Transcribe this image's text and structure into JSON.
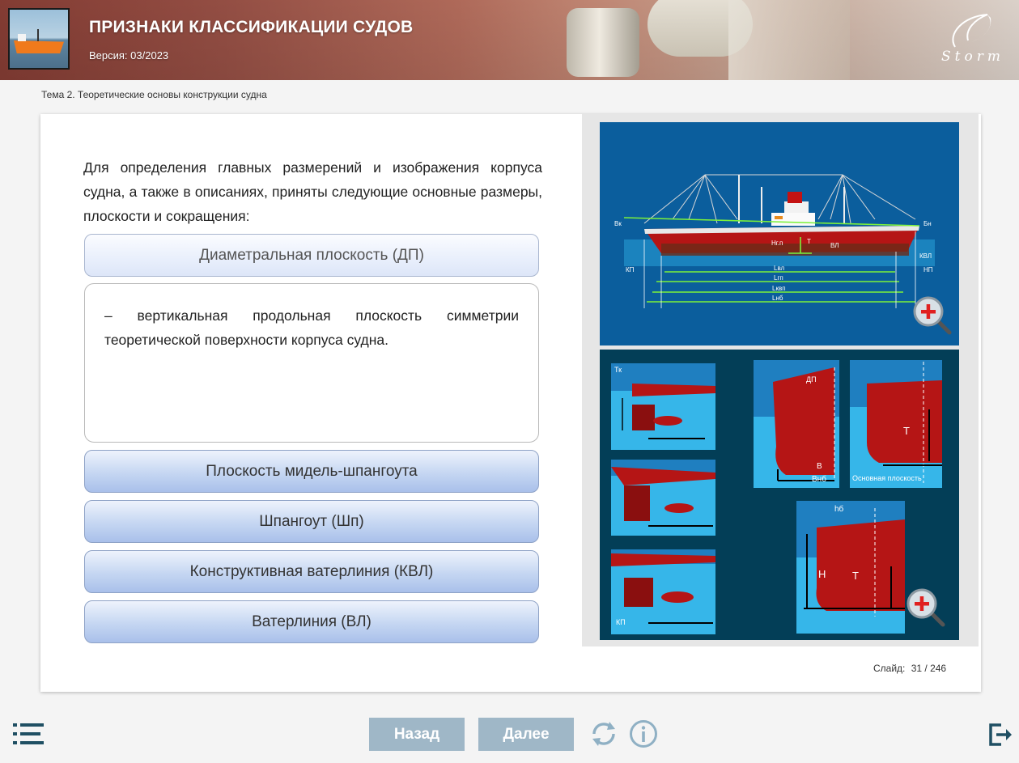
{
  "header": {
    "title": "ПРИЗНАКИ КЛАССИФИКАЦИИ СУДОВ",
    "version": "Версия: 03/2023",
    "logo_text": "Storm"
  },
  "topic": "Тема 2. Теоретические основы конструкции судна",
  "main": {
    "intro": "Для определения главных размерений и изображения корпуса судна, а также в описаниях, приняты следующие основные размеры, плоскости и сокращения:",
    "terms": [
      {
        "label": "Диаметральная плоскость (ДП)",
        "active": true
      },
      {
        "label": "Плоскость мидель-шпангоута",
        "active": false
      },
      {
        "label": "Шпангоут (Шп)",
        "active": false
      },
      {
        "label": "Конструктивная ватерлиния (КВЛ)",
        "active": false
      },
      {
        "label": "Ватерлиния (ВЛ)",
        "active": false
      }
    ],
    "definition": "– вертикальная продольная плоскость симметрии теоретической поверхности корпуса судна."
  },
  "figure_top": {
    "labels": {
      "bk": "Вк",
      "bn": "Бн",
      "kp": "КП",
      "np": "НП",
      "kvl": "КВЛ",
      "vl": "ВЛ",
      "t": "Т",
      "hgp": "Нг.п",
      "lvl": "Lвл",
      "lgp": "Lгп",
      "lkvp": "Lквп",
      "lnb": "Lнб"
    }
  },
  "figure_bottom": {
    "labels": {
      "tk": "Тк",
      "kp": "КП",
      "dp": "ДП",
      "b": "В",
      "bnb": "Внб",
      "t1": "Т",
      "t2": "Т",
      "base_plane": "Основная плоскость",
      "hb": "hб",
      "h": "Н"
    }
  },
  "slide": {
    "label": "Слайд:",
    "value": "31 / 246"
  },
  "footer": {
    "back": "Назад",
    "next": "Далее"
  },
  "colors": {
    "nav_button": "#9fb7c7",
    "term_button": "#c5d6f2",
    "hull_red": "#b51515",
    "panel_blue": "#0b5e9d"
  },
  "icons": [
    "menu-icon",
    "refresh-icon",
    "info-icon",
    "exit-icon",
    "zoom-icon"
  ]
}
